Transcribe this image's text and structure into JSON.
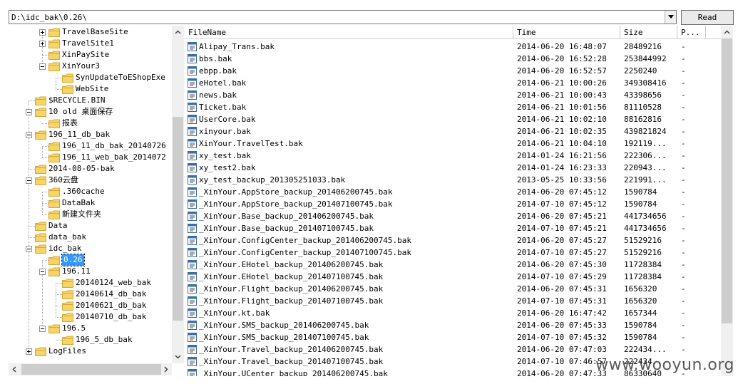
{
  "path": {
    "value": "D:\\idc_bak\\0.26\\"
  },
  "read_button": {
    "label": "Read"
  },
  "tree": {
    "items": [
      {
        "label": "TravelBaseSite",
        "expander": "plus"
      },
      {
        "label": "TravelSite1",
        "expander": "plus"
      },
      {
        "label": "XinPaySite",
        "expander": "none"
      },
      {
        "label": "XinYour3",
        "expander": "minus"
      },
      {
        "label": "SynUpdateToEShopExe",
        "expander": "none"
      },
      {
        "label": "WebSite",
        "expander": "none"
      },
      {
        "label": "$RECYCLE.BIN",
        "expander": "none"
      },
      {
        "label": "10 old 桌面保存",
        "expander": "minus"
      },
      {
        "label": "报表",
        "expander": "none"
      },
      {
        "label": "196_11_db_bak",
        "expander": "minus"
      },
      {
        "label": "196_11_db_bak_20140726",
        "expander": "none"
      },
      {
        "label": "196_11_web_bak_2014072",
        "expander": "none"
      },
      {
        "label": "2014-08-05-bak",
        "expander": "none"
      },
      {
        "label": "360云盘",
        "expander": "minus"
      },
      {
        "label": ".360cache",
        "expander": "none"
      },
      {
        "label": "DataBak",
        "expander": "none"
      },
      {
        "label": "新建文件夹",
        "expander": "none"
      },
      {
        "label": "Data",
        "expander": "none"
      },
      {
        "label": "data_bak",
        "expander": "none"
      },
      {
        "label": "idc_bak",
        "expander": "minus"
      },
      {
        "label": "0.26",
        "expander": "none",
        "selected": true
      },
      {
        "label": "196.11",
        "expander": "minus"
      },
      {
        "label": "20140124_web_bak",
        "expander": "none"
      },
      {
        "label": "20140614_db_bak",
        "expander": "none"
      },
      {
        "label": "20140621_db_bak",
        "expander": "none"
      },
      {
        "label": "20140710_db_bak",
        "expander": "none"
      },
      {
        "label": "196.5",
        "expander": "minus"
      },
      {
        "label": "196_5_db_bak",
        "expander": "none"
      },
      {
        "label": "LogFiles",
        "expander": "plus"
      }
    ]
  },
  "list": {
    "columns": [
      "FileName",
      "Time",
      "Size",
      "P..."
    ],
    "rows": [
      [
        "Alipay_Trans.bak",
        "2014-06-20 16:48:07",
        "28489216",
        "-"
      ],
      [
        "bbs.bak",
        "2014-06-20 16:52:28",
        "253844992",
        "-"
      ],
      [
        "ebpp.bak",
        "2014-06-20 16:52:57",
        "2250240",
        "-"
      ],
      [
        "eHotel.bak",
        "2014-06-21 10:00:26",
        "349308416",
        "-"
      ],
      [
        "news.bak",
        "2014-06-21 10:00:43",
        "43398656",
        "-"
      ],
      [
        "Ticket.bak",
        "2014-06-21 10:01:56",
        "81110528",
        "-"
      ],
      [
        "UserCore.bak",
        "2014-06-21 10:02:10",
        "88162816",
        "-"
      ],
      [
        "xinyour.bak",
        "2014-06-21 10:02:35",
        "439821824",
        "-"
      ],
      [
        "XinYour.TravelTest.bak",
        "2014-06-21 10:04:10",
        "192119...",
        "-"
      ],
      [
        "xy_test.bak",
        "2014-01-24 16:21:56",
        "222306...",
        "-"
      ],
      [
        "xy_test2.bak",
        "2014-01-24 16:23:33",
        "220943...",
        "-"
      ],
      [
        "xy_test_backup_201305251033.bak",
        "2013-05-25 10:33:56",
        "221991...",
        "-"
      ],
      [
        "_XinYour.AppStore_backup_201406200745.bak",
        "2014-06-20 07:45:12",
        "1590784",
        "-"
      ],
      [
        "_XinYour.AppStore_backup_201407100745.bak",
        "2014-07-10 07:45:12",
        "1590784",
        "-"
      ],
      [
        "_XinYour.Base_backup_201406200745.bak",
        "2014-06-20 07:45:21",
        "441734656",
        "-"
      ],
      [
        "_XinYour.Base_backup_201407100745.bak",
        "2014-07-10 07:45:21",
        "441734656",
        "-"
      ],
      [
        "_XinYour.ConfigCenter_backup_201406200745.bak",
        "2014-06-20 07:45:27",
        "51529216",
        "-"
      ],
      [
        "_XinYour.ConfigCenter_backup_201407100745.bak",
        "2014-07-10 07:45:27",
        "51529216",
        "-"
      ],
      [
        "_XinYour.EHotel_backup_201406200745.bak",
        "2014-06-20 07:45:30",
        "11728384",
        "-"
      ],
      [
        "_XinYour.EHotel_backup_201407100745.bak",
        "2014-07-10 07:45:29",
        "11728384",
        "-"
      ],
      [
        "_XinYour.Flight_backup_201406200745.bak",
        "2014-06-20 07:45:31",
        "1656320",
        "-"
      ],
      [
        "_XinYour.Flight_backup_201407100745.bak",
        "2014-07-10 07:45:31",
        "1656320",
        "-"
      ],
      [
        "_XinYour.kt.bak",
        "2014-06-20 16:47:42",
        "1657344",
        "-"
      ],
      [
        "_XinYour.SMS_backup_201406200745.bak",
        "2014-06-20 07:45:33",
        "1590784",
        "-"
      ],
      [
        "_XinYour.SMS_backup_201407100745.bak",
        "2014-07-10 07:45:32",
        "1590784",
        "-"
      ],
      [
        "_XinYour.Travel_backup_201406200745.bak",
        "2014-06-20 07:47:03",
        "222434...",
        "-"
      ],
      [
        "_XinYour.Travel_backup_201407100745.bak",
        "2014-07-10 07:46:57",
        "222434...",
        "-"
      ],
      [
        "_XinYour.UCenter_backup_201406200745.bak",
        "2014-06-20 07:47:33",
        "86330640",
        "-"
      ]
    ]
  },
  "watermark": "www.wooyun.org",
  "colors": {
    "selection": "#3399ff",
    "folder": "#f5d46b",
    "folder_dark": "#d8a92f",
    "file_icon": "#3a6ea8"
  }
}
